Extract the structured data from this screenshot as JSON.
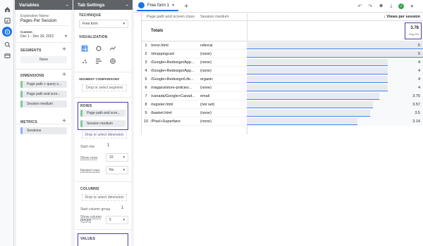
{
  "variables": {
    "title": "Variables",
    "exploration_name_label": "Exploration Name:",
    "exploration_name": "Pages Per Session",
    "date_preset": "Custom",
    "date_range": "Dec 1 - Dec 30, 2022",
    "segments_label": "SEGMENTS",
    "segments_none": "None",
    "dimensions_label": "DIMENSIONS",
    "dimensions": [
      "Page path + query s...",
      "Page path and scre...",
      "Session medium"
    ],
    "metrics_label": "METRICS",
    "metrics": [
      "Sessions"
    ]
  },
  "tab_settings": {
    "title": "Tab Settings",
    "technique_label": "TECHNIQUE",
    "technique_value": "Free form",
    "visualization_label": "VISUALIZATION",
    "segment_comparisons_label": "SEGMENT COMPARISONS",
    "segment_drop": "Drop or select segment",
    "rows_label": "ROWS",
    "rows": [
      "Page path and scre...",
      "Session medium"
    ],
    "dimension_drop": "Drop or select dimension",
    "start_row_label": "Start row",
    "start_row_value": "1",
    "show_rows_label": "Show rows",
    "show_rows_value": "10",
    "nested_rows_label": "Nested rows",
    "nested_rows_value": "No",
    "columns_label": "COLUMNS",
    "column_drop": "Drop or select dimension",
    "start_column_group_label": "Start column group",
    "start_column_group_value": "1",
    "show_column_groups_label": "Show column groups",
    "show_column_groups_value": "5",
    "values_label": "VALUES"
  },
  "main": {
    "tab_label": "Free form 1",
    "col_dimension_1": "Page path and screen class",
    "col_dimension_2": "Session medium",
    "col_metric": "↓ Views per session",
    "totals_label": "Totals",
    "totals_value": "3.78",
    "totals_sub": "Avg 0%",
    "rows": [
      {
        "num": "1",
        "page": "/error.html",
        "medium": "referral",
        "value": "5",
        "frac": 1.0
      },
      {
        "num": "2",
        "page": "/shoppingcart",
        "medium": "(none)",
        "value": "5",
        "frac": 1.0
      },
      {
        "num": "3",
        "page": "/Google+Redesign/App...",
        "medium": "(none)",
        "value": "4",
        "frac": 0.8
      },
      {
        "num": "4",
        "page": "/Google+Redesign/App...",
        "medium": "(none)",
        "value": "4",
        "frac": 0.8
      },
      {
        "num": "5",
        "page": "/Google+Redesign/Life...",
        "medium": "organic",
        "value": "4",
        "frac": 0.8
      },
      {
        "num": "6",
        "page": "/niagara/store-policies...",
        "medium": "(none)",
        "value": "4",
        "frac": 0.8
      },
      {
        "num": "7",
        "page": "/canada/Google+Canad...",
        "medium": "email",
        "value": "3.75",
        "frac": 0.75
      },
      {
        "num": "8",
        "page": "/register.html",
        "medium": "(not set)",
        "value": "3.57",
        "frac": 0.714
      },
      {
        "num": "9",
        "page": "/basket.html",
        "medium": "(none)",
        "value": "3.5",
        "frac": 0.7
      },
      {
        "num": "10",
        "page": "/Pixel+Superfans",
        "medium": "(none)",
        "value": "3.14",
        "frac": 0.628
      }
    ]
  },
  "colors": {
    "accent": "#1a73e8",
    "highlight": "#4a3aa8",
    "panel_header": "#5f6368"
  }
}
